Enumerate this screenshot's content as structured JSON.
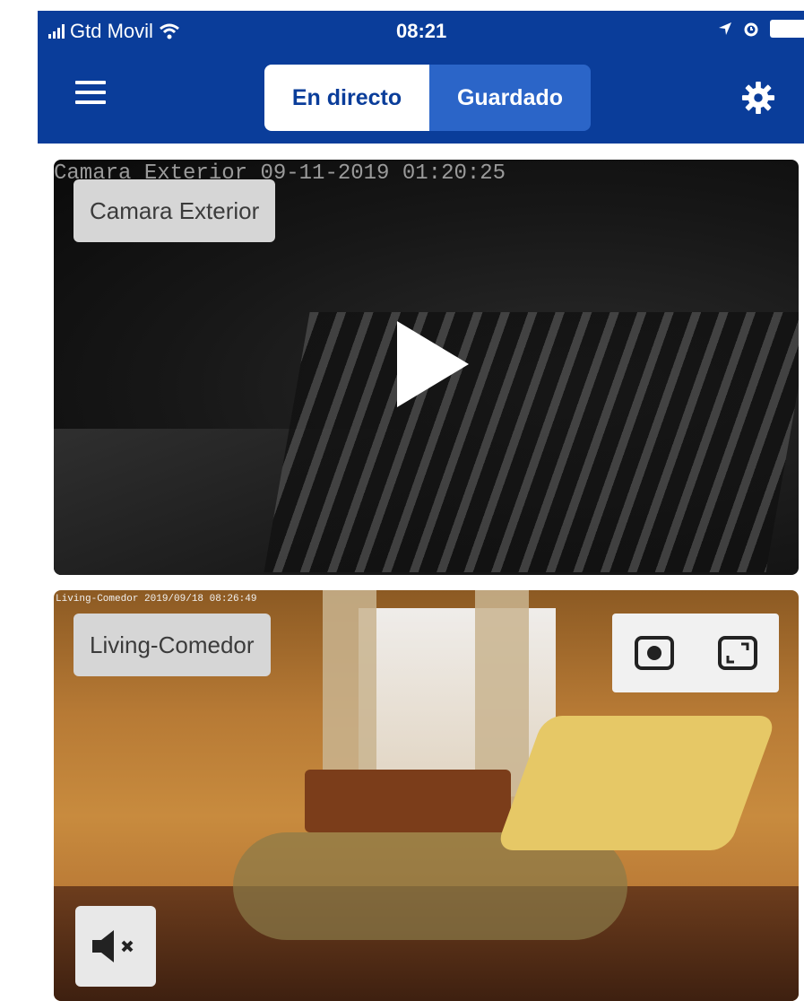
{
  "status_bar": {
    "carrier": "Gtd Movil",
    "time": "08:21"
  },
  "nav": {
    "tab_live": "En directo",
    "tab_saved": "Guardado",
    "active_tab": "En directo",
    "menu_icon": "hamburger-menu-icon",
    "settings_icon": "gear-icon"
  },
  "cameras": [
    {
      "name": "Camara Exterior",
      "osd": "Camara Exterior   09-11-2019 01:20:25",
      "state": "paused",
      "play_icon": "play-icon"
    },
    {
      "name": "Living-Comedor",
      "osd": "Living-Comedor 2019/09/18 08:26:49",
      "state": "playing",
      "record_icon": "record-icon",
      "fullscreen_icon": "fullscreen-icon",
      "mute_icon": "speaker-muted-icon"
    }
  ],
  "colors": {
    "header_bg": "#0a3d9a",
    "tab_active_bg": "#ffffff",
    "tab_inactive_bg": "#2b65c8"
  }
}
